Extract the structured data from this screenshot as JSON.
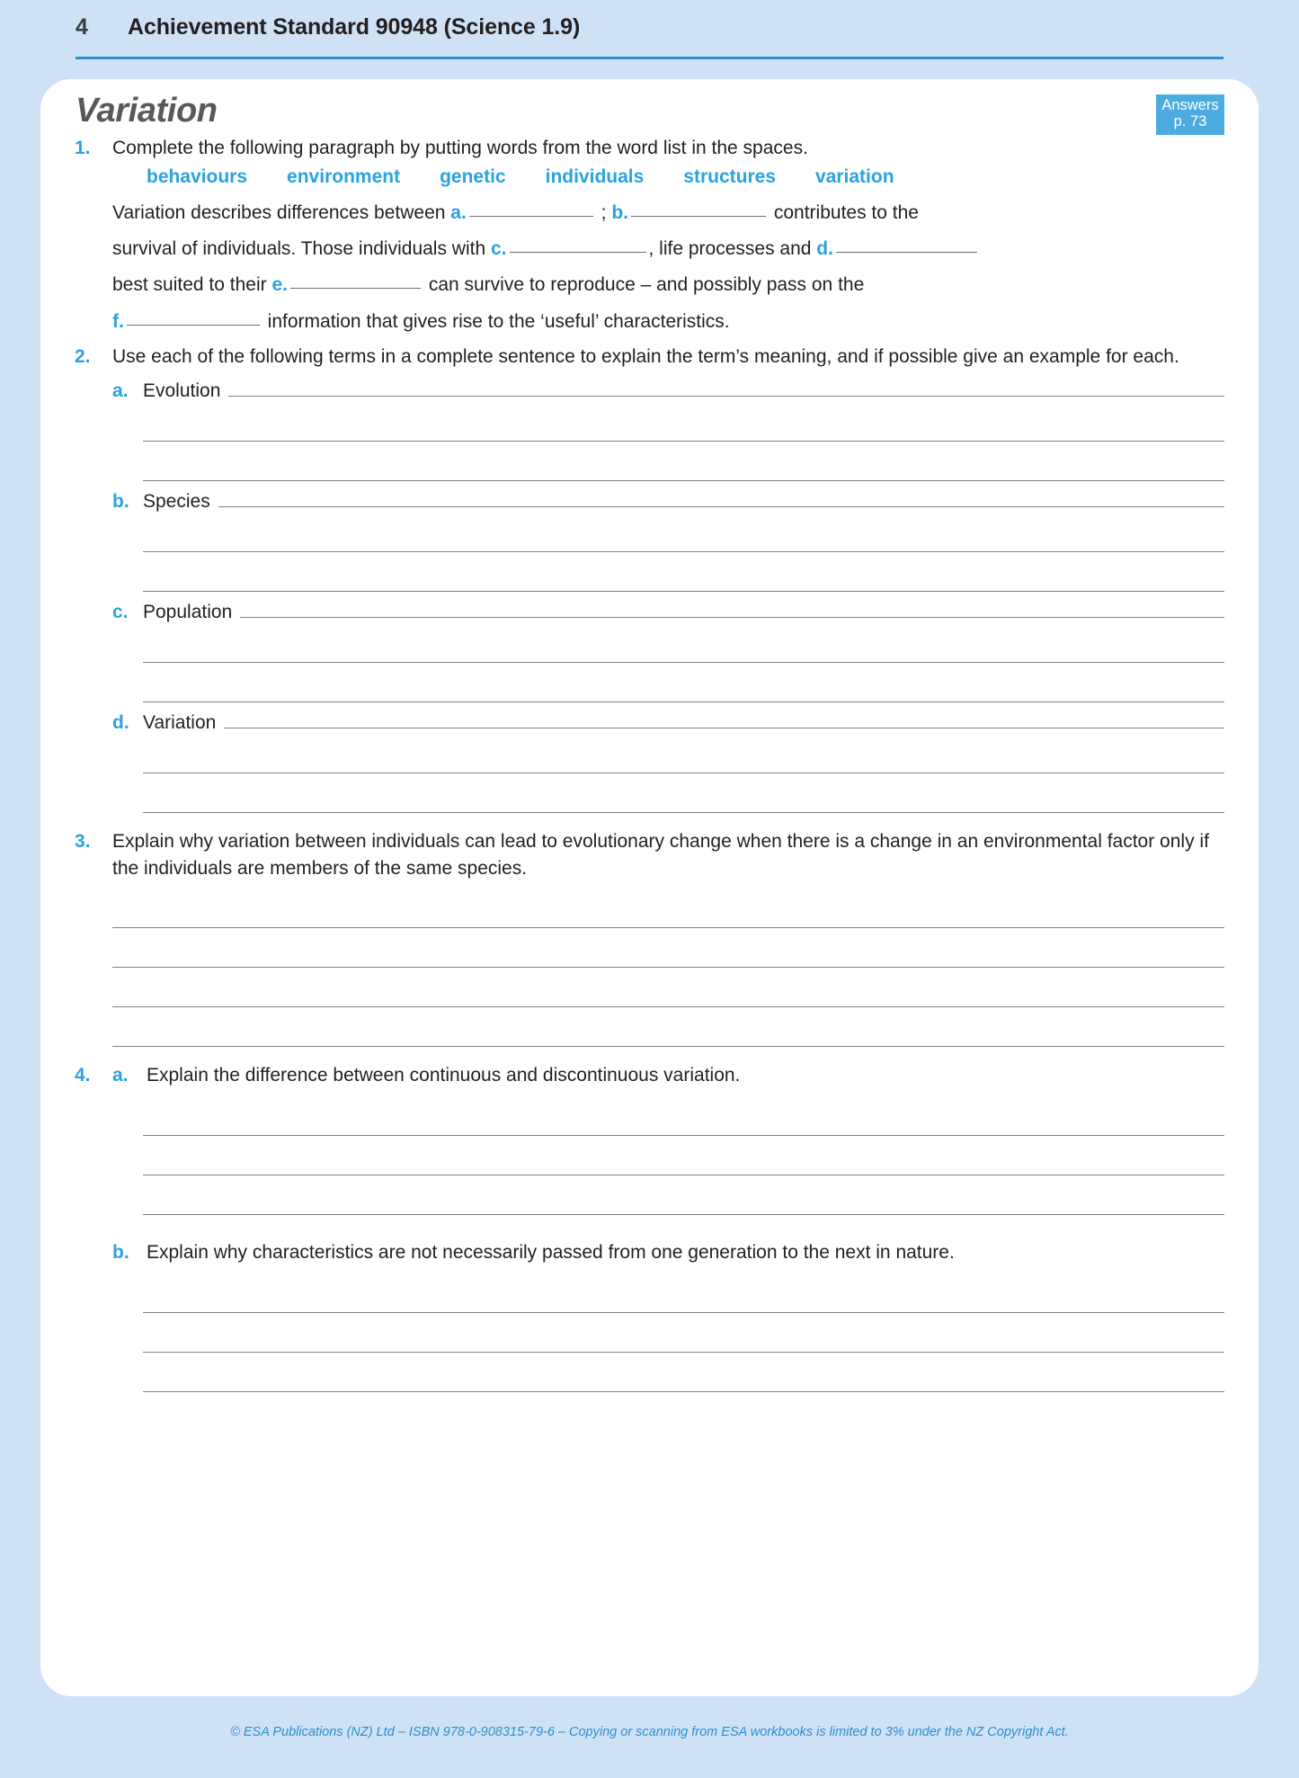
{
  "running_head": {
    "page_number": "4",
    "title": "Achievement Standard 90948 (Science 1.9)",
    "rule_color": "#2b8ed0"
  },
  "theme": {
    "page_background": "#cfe2f5",
    "sheet_background": "#ffffff",
    "accent_blue": "#29a3e0",
    "badge_blue": "#4dacdf",
    "title_gray": "#58595b",
    "rule_gray": "#808285"
  },
  "answers_badge": {
    "line1": "Answers",
    "line2": "p. 73"
  },
  "section": {
    "title": "Variation"
  },
  "questions": {
    "q1": {
      "number": "1.",
      "prompt": "Complete the following paragraph by putting words from the word list in the spaces.",
      "word_list": [
        "behaviours",
        "environment",
        "genetic",
        "individuals",
        "structures",
        "variation"
      ],
      "cloze": {
        "line1_a": "Variation describes differences between",
        "label_a": "a.",
        "line1_b": ";",
        "label_b": "b.",
        "line1_c": "contributes to the",
        "line2_a": "survival of individuals. Those individuals with",
        "label_c": "c.",
        "line2_b": ", life processes and",
        "label_d": "d.",
        "line3_a": "best suited to their",
        "label_e": "e.",
        "line3_b": "can survive to reproduce – and possibly pass on the",
        "label_f": "f.",
        "line4_b": "information that gives rise to the ‘useful’ characteristics."
      }
    },
    "q2": {
      "number": "2.",
      "prompt": "Use each of the following terms in a complete sentence to explain the term’s meaning, and if possible give an example for each.",
      "items": [
        {
          "letter": "a.",
          "term": "Evolution"
        },
        {
          "letter": "b.",
          "term": "Species"
        },
        {
          "letter": "c.",
          "term": "Population"
        },
        {
          "letter": "d.",
          "term": "Variation"
        }
      ]
    },
    "q3": {
      "number": "3.",
      "prompt": "Explain why variation between individuals can lead to evolutionary change when there is a change in an environmental factor only if the individuals are members of the same species."
    },
    "q4": {
      "number": "4.",
      "items": [
        {
          "letter": "a.",
          "prompt": "Explain the difference between continuous and discontinuous variation."
        },
        {
          "letter": "b.",
          "prompt": "Explain why characteristics are not necessarily passed from one generation to the next in nature."
        }
      ]
    }
  },
  "footer": {
    "text": "© ESA Publications (NZ) Ltd  –  ISBN 978-0-908315-79-6  –  Copying or scanning from ESA workbooks is limited to 3% under the NZ Copyright Act."
  }
}
